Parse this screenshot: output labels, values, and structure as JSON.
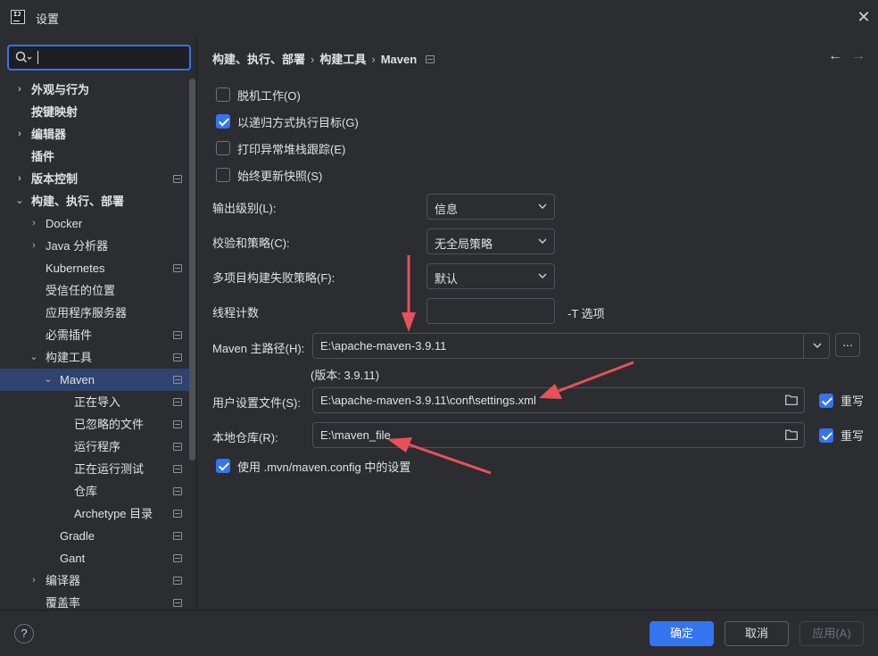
{
  "window": {
    "title": "设置",
    "close_glyph": "✕"
  },
  "search": {
    "value": "",
    "placeholder": ""
  },
  "tree": [
    {
      "label": "外观与行为",
      "level": 0,
      "chevron": "›",
      "bold": true,
      "proj": false,
      "selected": false
    },
    {
      "label": "按键映射",
      "level": 0,
      "chevron": "",
      "bold": true,
      "proj": false,
      "selected": false
    },
    {
      "label": "编辑器",
      "level": 0,
      "chevron": "›",
      "bold": true,
      "proj": false,
      "selected": false
    },
    {
      "label": "插件",
      "level": 0,
      "chevron": "",
      "bold": true,
      "proj": false,
      "selected": false
    },
    {
      "label": "版本控制",
      "level": 0,
      "chevron": "›",
      "bold": true,
      "proj": true,
      "selected": false
    },
    {
      "label": "构建、执行、部署",
      "level": 0,
      "chevron": "⌄",
      "bold": true,
      "proj": false,
      "selected": false
    },
    {
      "label": "Docker",
      "level": 1,
      "chevron": "›",
      "bold": false,
      "proj": false,
      "selected": false
    },
    {
      "label": "Java 分析器",
      "level": 1,
      "chevron": "›",
      "bold": false,
      "proj": false,
      "selected": false
    },
    {
      "label": "Kubernetes",
      "level": 1,
      "chevron": "",
      "bold": false,
      "proj": true,
      "selected": false
    },
    {
      "label": "受信任的位置",
      "level": 1,
      "chevron": "",
      "bold": false,
      "proj": false,
      "selected": false
    },
    {
      "label": "应用程序服务器",
      "level": 1,
      "chevron": "",
      "bold": false,
      "proj": false,
      "selected": false
    },
    {
      "label": "必需插件",
      "level": 1,
      "chevron": "",
      "bold": false,
      "proj": true,
      "selected": false
    },
    {
      "label": "构建工具",
      "level": 1,
      "chevron": "⌄",
      "bold": false,
      "proj": true,
      "selected": false
    },
    {
      "label": "Maven",
      "level": 2,
      "chevron": "⌄",
      "bold": false,
      "proj": true,
      "selected": true
    },
    {
      "label": "正在导入",
      "level": 3,
      "chevron": "",
      "bold": false,
      "proj": true,
      "selected": false
    },
    {
      "label": "已忽略的文件",
      "level": 3,
      "chevron": "",
      "bold": false,
      "proj": true,
      "selected": false
    },
    {
      "label": "运行程序",
      "level": 3,
      "chevron": "",
      "bold": false,
      "proj": true,
      "selected": false
    },
    {
      "label": "正在运行测试",
      "level": 3,
      "chevron": "",
      "bold": false,
      "proj": true,
      "selected": false
    },
    {
      "label": "仓库",
      "level": 3,
      "chevron": "",
      "bold": false,
      "proj": true,
      "selected": false
    },
    {
      "label": "Archetype 目录",
      "level": 3,
      "chevron": "",
      "bold": false,
      "proj": true,
      "selected": false
    },
    {
      "label": "Gradle",
      "level": 2,
      "chevron": "",
      "bold": false,
      "proj": true,
      "selected": false
    },
    {
      "label": "Gant",
      "level": 2,
      "chevron": "",
      "bold": false,
      "proj": true,
      "selected": false
    },
    {
      "label": "编译器",
      "level": 1,
      "chevron": "›",
      "bold": false,
      "proj": true,
      "selected": false
    },
    {
      "label": "覆盖率",
      "level": 1,
      "chevron": "",
      "bold": false,
      "proj": true,
      "selected": false
    }
  ],
  "breadcrumb": {
    "part1": "构建、执行、部署",
    "part2": "构建工具",
    "part3": "Maven",
    "sep": "›"
  },
  "nav": {
    "back": "←",
    "forward": "→"
  },
  "checkboxes": {
    "offline": {
      "label": "脱机工作(O)",
      "checked": false
    },
    "recursive": {
      "label": "以递归方式执行目标(G)",
      "checked": true
    },
    "stacktrace": {
      "label": "打印异常堆栈跟踪(E)",
      "checked": false
    },
    "snapshots": {
      "label": "始终更新快照(S)",
      "checked": false
    },
    "mvn_config": {
      "label": "使用 .mvn/maven.config 中的设置",
      "checked": true
    }
  },
  "fields": {
    "output_level": {
      "label": "输出级别(L):",
      "value": "信息"
    },
    "checksum": {
      "label": "校验和策略(C):",
      "value": "无全局策略"
    },
    "multiproject": {
      "label": "多项目构建失败策略(F):",
      "value": "默认"
    },
    "threads": {
      "label": "线程计数",
      "value": "",
      "hint": "-T 选项"
    },
    "maven_home": {
      "label": "Maven 主路径(H):",
      "value": "E:\\apache-maven-3.9.11",
      "version": "(版本: 3.9.11)",
      "browse": "..."
    },
    "user_settings": {
      "label": "用户设置文件(S):",
      "value": "E:\\apache-maven-3.9.11\\conf\\settings.xml",
      "override_label": "重写",
      "override": true
    },
    "local_repo": {
      "label": "本地仓库(R):",
      "value": "E:\\maven_file",
      "override_label": "重写",
      "override": true
    }
  },
  "footer": {
    "help": "?",
    "ok": "确定",
    "cancel": "取消",
    "apply": "应用(A)"
  },
  "colors": {
    "accent": "#3574f0",
    "annotation_arrow": "#e8505b",
    "background": "#2b2d30"
  }
}
